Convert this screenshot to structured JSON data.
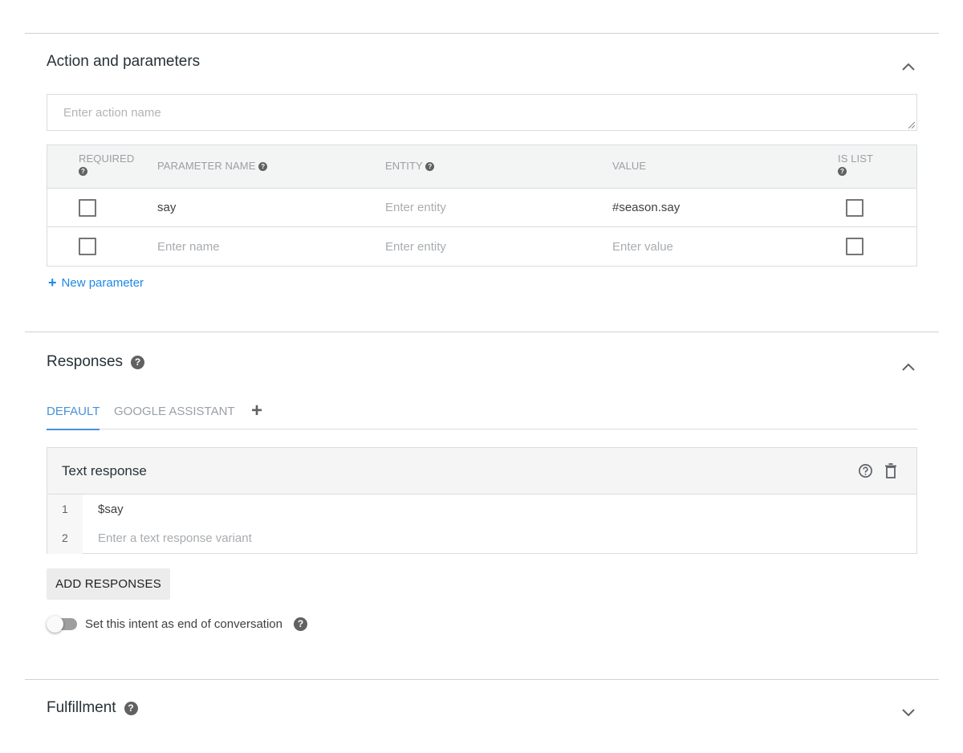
{
  "action_section": {
    "title": "Action and parameters",
    "collapse_icon": "chevron-up-icon",
    "action_name_placeholder": "Enter action name",
    "action_name_value": "",
    "table": {
      "headers": {
        "required": "REQUIRED",
        "parameter_name": "PARAMETER NAME",
        "entity": "ENTITY",
        "value": "VALUE",
        "is_list": "IS LIST"
      },
      "help_icon": "?",
      "rows": [
        {
          "required": false,
          "name": "say",
          "name_placeholder": "Enter name",
          "entity": "",
          "entity_placeholder": "Enter entity",
          "value": "#season.say",
          "value_placeholder": "Enter value",
          "is_list": false
        },
        {
          "required": false,
          "name": "",
          "name_placeholder": "Enter name",
          "entity": "",
          "entity_placeholder": "Enter entity",
          "value": "",
          "value_placeholder": "Enter value",
          "is_list": false
        }
      ]
    },
    "new_parameter_plus": "+",
    "new_parameter_label": "New parameter"
  },
  "responses_section": {
    "title": "Responses",
    "help_icon": "?",
    "collapse_icon": "chevron-up-icon",
    "tabs": [
      {
        "label": "DEFAULT",
        "active": true
      },
      {
        "label": "GOOGLE ASSISTANT",
        "active": false
      }
    ],
    "add_tab_icon": "+",
    "text_response": {
      "title": "Text response",
      "lines": [
        {
          "number": "1",
          "text": "$say",
          "placeholder": ""
        },
        {
          "number": "2",
          "text": "",
          "placeholder": "Enter a text response variant"
        }
      ]
    },
    "add_responses_label": "ADD RESPONSES",
    "end_conversation": {
      "label": "Set this intent as end of conversation",
      "enabled": false
    }
  },
  "fulfillment_section": {
    "title": "Fulfillment",
    "help_icon": "?",
    "collapse_icon": "chevron-down-icon"
  },
  "colors": {
    "accent": "#1e88e5",
    "tab_active": "#4a90d9",
    "divider": "#d4d0d0",
    "header_bg": "#f3f4f4"
  }
}
